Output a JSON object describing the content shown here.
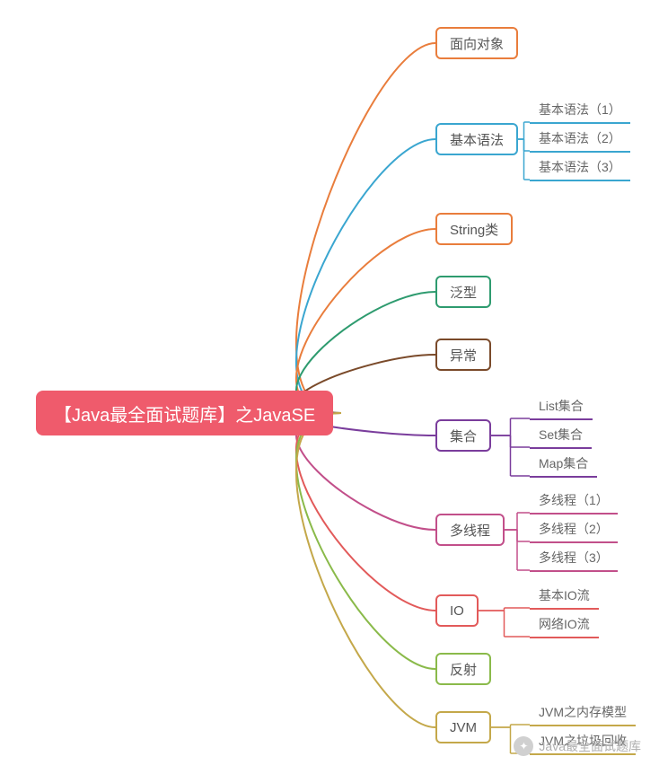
{
  "root": {
    "label": "【Java最全面试题库】之JavaSE",
    "color": "#ef5b6c"
  },
  "branches": [
    {
      "id": "oo",
      "label": "面向对象",
      "color": "#e97d3c",
      "children": []
    },
    {
      "id": "syntax",
      "label": "基本语法",
      "color": "#3aa6d0",
      "children": [
        {
          "label": "基本语法（1）"
        },
        {
          "label": "基本语法（2）"
        },
        {
          "label": "基本语法（3）"
        }
      ]
    },
    {
      "id": "string",
      "label": "String类",
      "color": "#e97d3c",
      "children": []
    },
    {
      "id": "generic",
      "label": "泛型",
      "color": "#2e9b6f",
      "children": []
    },
    {
      "id": "except",
      "label": "异常",
      "color": "#7a4a2a",
      "children": []
    },
    {
      "id": "coll",
      "label": "集合",
      "color": "#7a3d9c",
      "children": [
        {
          "label": "List集合"
        },
        {
          "label": "Set集合"
        },
        {
          "label": "Map集合"
        }
      ]
    },
    {
      "id": "thread",
      "label": "多线程",
      "color": "#c24f8a",
      "children": [
        {
          "label": "多线程（1）"
        },
        {
          "label": "多线程（2）"
        },
        {
          "label": "多线程（3）"
        }
      ]
    },
    {
      "id": "io",
      "label": "IO",
      "color": "#e25a5a",
      "children": [
        {
          "label": "基本IO流"
        },
        {
          "label": "网络IO流"
        }
      ]
    },
    {
      "id": "reflect",
      "label": "反射",
      "color": "#8aba4a",
      "children": []
    },
    {
      "id": "jvm",
      "label": "JVM",
      "color": "#c4a84a",
      "children": [
        {
          "label": "JVM之内存模型"
        },
        {
          "label": "JVM之垃圾回收"
        }
      ]
    }
  ],
  "watermark": "Java最全面试题库"
}
